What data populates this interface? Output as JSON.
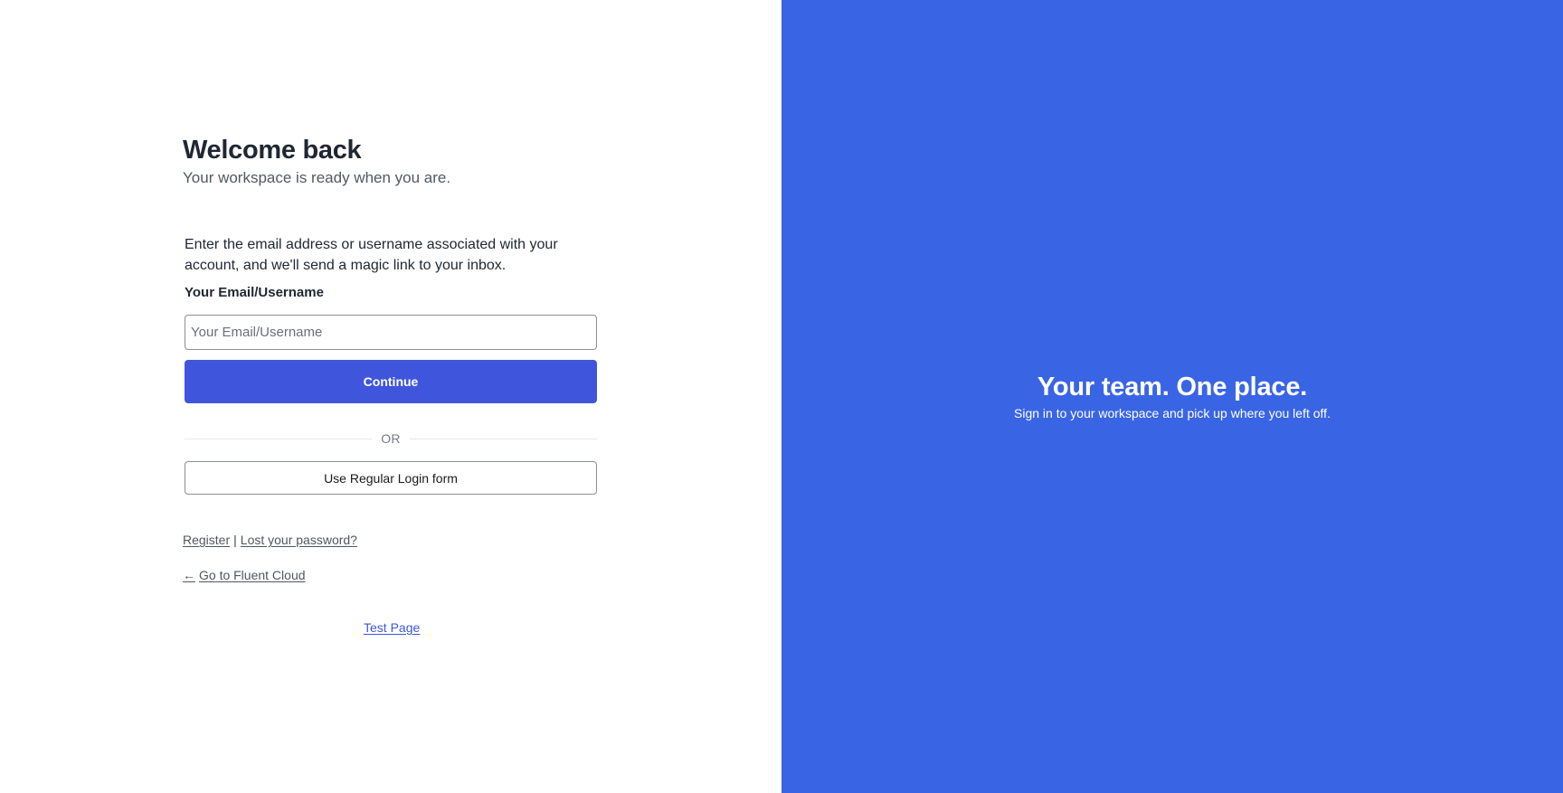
{
  "login": {
    "heading": "Welcome back",
    "subheading": "Your workspace is ready when you are.",
    "instructions": "Enter the email address or username associated with your account, and we'll send a magic link to your inbox.",
    "email_label": "Your Email/Username",
    "email_placeholder": "Your Email/Username",
    "email_value": "",
    "continue_label": "Continue",
    "or_text": "OR",
    "regular_login_label": "Use Regular Login form",
    "register_label": "Register",
    "separator": "|",
    "lost_password_label": "Lost your password?",
    "back_arrow": "←",
    "back_label": "Go to Fluent Cloud",
    "test_page_label": "Test Page"
  },
  "promo": {
    "title": "Your team. One place.",
    "subtitle": "Sign in to your workspace and pick up where you left off."
  },
  "colors": {
    "promo_background": "#3965e5",
    "primary_button": "#3f56dc",
    "heading_text": "#1f2733"
  }
}
